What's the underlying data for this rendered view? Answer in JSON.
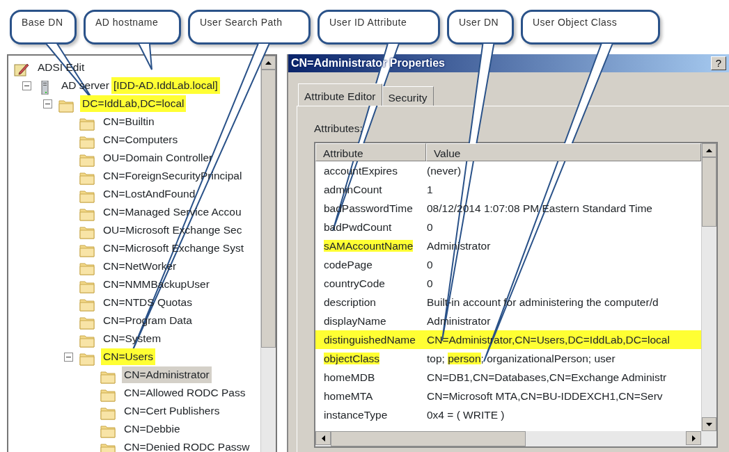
{
  "callouts": [
    {
      "text": "Base DN"
    },
    {
      "text": "AD hostname"
    },
    {
      "text": "User Search Path"
    },
    {
      "text": "User ID Attribute"
    },
    {
      "text": "User DN"
    },
    {
      "text": "User Object Class"
    }
  ],
  "tree": {
    "title": "ADSI Edit",
    "items": [
      {
        "label": "AD server",
        "hostname": "[IDD-AD.IddLab.local]",
        "hostname_highlighted": true,
        "highlighted": false,
        "selected": false,
        "expanded": true,
        "children": [
          {
            "label": "DC=IddLab,DC=local",
            "highlighted": true,
            "selected": false,
            "expanded": true,
            "children": [
              {
                "label": "CN=Builtin",
                "highlighted": false,
                "selected": false
              },
              {
                "label": "CN=Computers",
                "highlighted": false,
                "selected": false
              },
              {
                "label": "OU=Domain Controller",
                "highlighted": false,
                "selected": false
              },
              {
                "label": "CN=ForeignSecurityPrincipal",
                "highlighted": false,
                "selected": false
              },
              {
                "label": "CN=LostAndFound",
                "highlighted": false,
                "selected": false
              },
              {
                "label": "CN=Managed Service Accou",
                "highlighted": false,
                "selected": false
              },
              {
                "label": "OU=Microsoft Exchange Sec",
                "highlighted": false,
                "selected": false
              },
              {
                "label": "CN=Microsoft Exchange Syst",
                "highlighted": false,
                "selected": false
              },
              {
                "label": "CN=NetWorker",
                "highlighted": false,
                "selected": false
              },
              {
                "label": "CN=NMMBackupUser",
                "highlighted": false,
                "selected": false
              },
              {
                "label": "CN=NTDS Quotas",
                "highlighted": false,
                "selected": false
              },
              {
                "label": "CN=Program Data",
                "highlighted": false,
                "selected": false
              },
              {
                "label": "CN=System",
                "highlighted": false,
                "selected": false
              },
              {
                "label": "CN=Users",
                "highlighted": true,
                "selected": false,
                "expanded": true,
                "children": [
                  {
                    "label": "CN=Administrator",
                    "highlighted": false,
                    "selected": true
                  },
                  {
                    "label": "CN=Allowed RODC Pass",
                    "highlighted": false,
                    "selected": false
                  },
                  {
                    "label": "CN=Cert Publishers",
                    "highlighted": false,
                    "selected": false
                  },
                  {
                    "label": "CN=Debbie",
                    "highlighted": false,
                    "selected": false
                  },
                  {
                    "label": "CN=Denied RODC Passw",
                    "highlighted": false,
                    "selected": false
                  }
                ]
              }
            ]
          }
        ]
      }
    ]
  },
  "dialog": {
    "title": "CN=Administrator Properties",
    "help_button": "?",
    "tabs": [
      {
        "label": "Attribute Editor",
        "selected": true
      },
      {
        "label": "Security",
        "selected": false
      }
    ],
    "attributes_label": "Attributes:",
    "table": {
      "columns": [
        "Attribute",
        "Value"
      ],
      "rows": [
        {
          "attribute": "accountExpires",
          "value": "(never)",
          "attribute_highlighted": false,
          "value_highlighted": false
        },
        {
          "attribute": "adminCount",
          "value": "1",
          "attribute_highlighted": false,
          "value_highlighted": false
        },
        {
          "attribute": "badPasswordTime",
          "value": "08/12/2014 1:07:08 PM Eastern Standard Time",
          "attribute_highlighted": false,
          "value_highlighted": false
        },
        {
          "attribute": "badPwdCount",
          "value": "0",
          "attribute_highlighted": false,
          "value_highlighted": false
        },
        {
          "attribute": "sAMAccountName",
          "value": "Administrator",
          "attribute_highlighted": true,
          "value_highlighted": false
        },
        {
          "attribute": "codePage",
          "value": "0",
          "attribute_highlighted": false,
          "value_highlighted": false
        },
        {
          "attribute": "countryCode",
          "value": "0",
          "attribute_highlighted": false,
          "value_highlighted": false
        },
        {
          "attribute": "description",
          "value": "Built-in account for administering the computer/d",
          "attribute_highlighted": false,
          "value_highlighted": false
        },
        {
          "attribute": "displayName",
          "value": "Administrator",
          "attribute_highlighted": false,
          "value_highlighted": false
        },
        {
          "attribute": "distinguishedName",
          "value": "CN=Administrator,CN=Users,DC=IddLab,DC=local",
          "attribute_highlighted": true,
          "value_highlighted": true
        },
        {
          "attribute": "objectClass",
          "value_parts": [
            {
              "text": "top; ",
              "highlighted": false
            },
            {
              "text": "person",
              "highlighted": true
            },
            {
              "text": "; organizationalPerson; user",
              "highlighted": false
            }
          ],
          "attribute_highlighted": true,
          "value_highlighted": false
        },
        {
          "attribute": "homeMDB",
          "value": "CN=DB1,CN=Databases,CN=Exchange Administr",
          "attribute_highlighted": false,
          "value_highlighted": false
        },
        {
          "attribute": "homeMTA",
          "value": "CN=Microsoft MTA,CN=BU-IDDEXCH1,CN=Serv",
          "attribute_highlighted": false,
          "value_highlighted": false
        },
        {
          "attribute": "instanceType",
          "value": "0x4 = ( WRITE )",
          "attribute_highlighted": false,
          "value_highlighted": false
        }
      ]
    }
  }
}
